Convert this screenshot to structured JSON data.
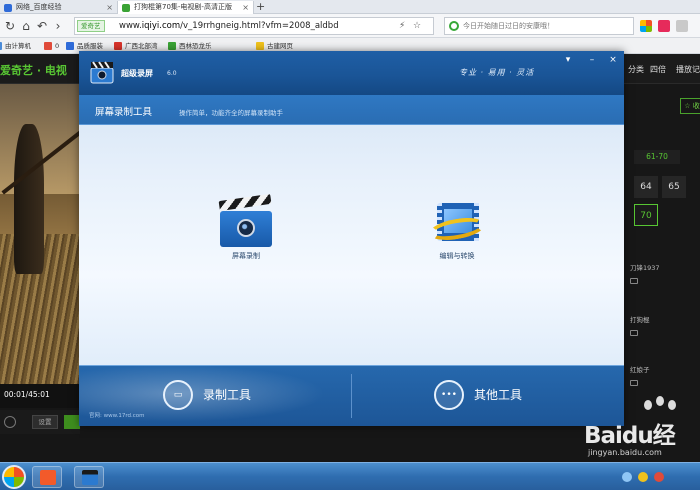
{
  "browser": {
    "tabs": [
      {
        "label": "网络_百度经验",
        "active": false
      },
      {
        "label": "打狗棍第70集-电视剧-高清正版",
        "active": true
      }
    ],
    "new_tab": "+",
    "site_badge": "爱奇艺",
    "url_prefix": "www.",
    "url_domain": "iqiyi.com",
    "url_path": "/v_19rrhgneig.html?vfm=2008_aldbd",
    "search_placeholder": "今日开始随日过日的安康哦！",
    "bookmarks": [
      "由计算机",
      "0",
      "品质服装",
      "广西北部湾",
      "西林恐龙乐",
      "古建网页"
    ]
  },
  "site": {
    "logo": "爱奇艺 · 电视",
    "nav_right": [
      "分类",
      "四倍",
      "播放记"
    ],
    "timecode": "00:01/45:01",
    "set_button": "设置",
    "side_button": "☆ 收",
    "episode_range": "61-70",
    "episodes": [
      "64",
      "65",
      "70"
    ],
    "selected_episode": "70",
    "recent": [
      "刀锋1937",
      "打狗棍",
      "红娘子"
    ]
  },
  "dialog": {
    "app_name": "超级录屏",
    "version": "6.0",
    "slogan": "专业 · 易用 · 灵活",
    "section_title": "屏幕录制工具",
    "section_hint": "操作简单，功能齐全的屏幕录制助手",
    "tools": [
      {
        "label": "屏幕录制",
        "icon": "clapperboard-icon"
      },
      {
        "label": "编辑与转换",
        "icon": "film-edit-icon"
      }
    ],
    "bottom_tabs": [
      {
        "label": "录制工具",
        "active": true
      },
      {
        "label": "其他工具",
        "active": false
      }
    ],
    "footer": "官网: www.17rd.com"
  },
  "watermark": {
    "brand": "Baidu经",
    "sub": "jingyan.baidu.com"
  },
  "colors": {
    "iqiyi_green": "#58c633",
    "dialog_blue": "#1f5fa6",
    "taskbar_blue": "#2f6db0"
  }
}
